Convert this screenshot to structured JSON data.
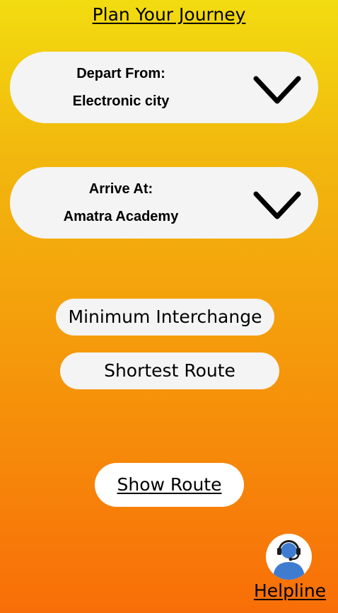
{
  "header": {
    "title": "Plan Your Journey"
  },
  "depart": {
    "label": "Depart From:",
    "value": "Electronic city"
  },
  "arrive": {
    "label": "Arrive At:",
    "value": "Amatra Academy"
  },
  "options": {
    "minimum_interchange": "Minimum Interchange",
    "shortest_route": "Shortest Route"
  },
  "actions": {
    "show_route": "Show Route"
  },
  "helpline": {
    "label": "Helpline",
    "icon": "headset-support-agent-icon"
  },
  "colors": {
    "gradient_top": "#f2dc10",
    "gradient_bottom": "#f86e08",
    "pill_background": "#f4f4f4",
    "avatar_blue": "#3f7ccf"
  }
}
